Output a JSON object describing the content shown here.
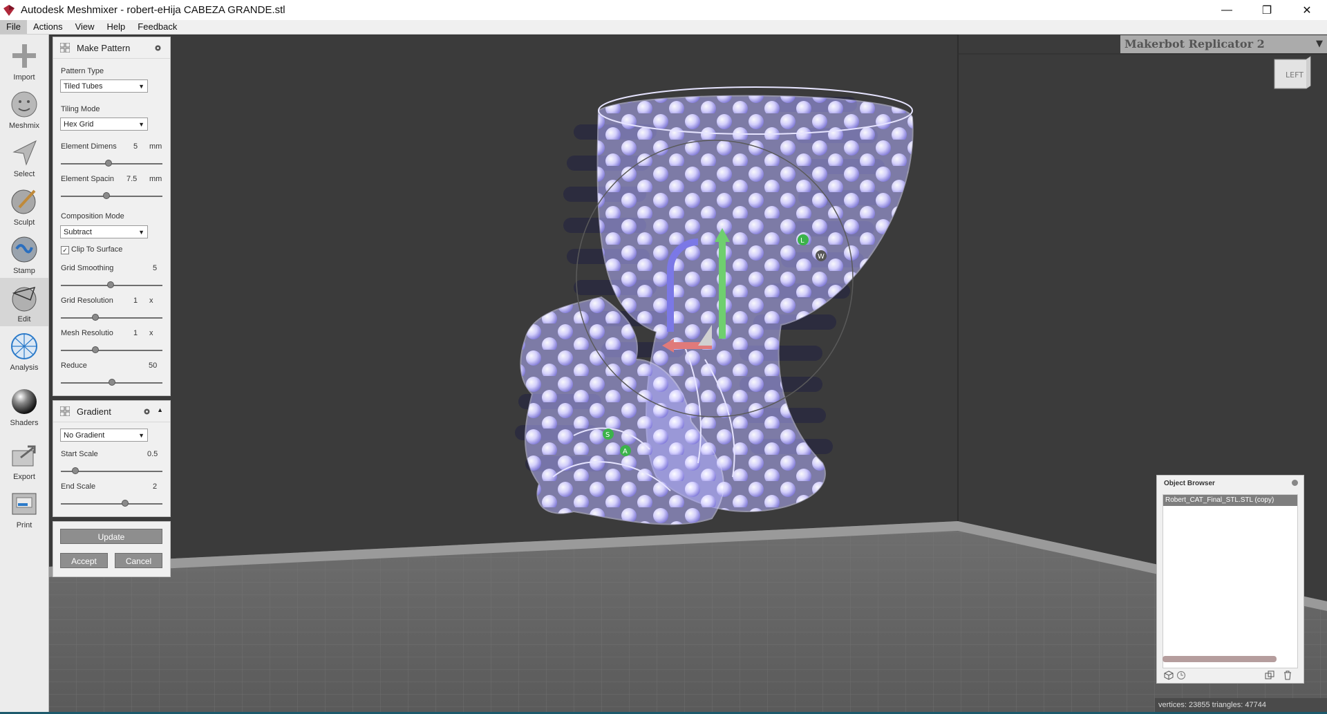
{
  "window": {
    "title": "Autodesk Meshmixer - robert-eHija CABEZA GRANDE.stl",
    "minimize": "—",
    "restore": "❐",
    "close": "✕"
  },
  "menu": [
    "File",
    "Actions",
    "View",
    "Help",
    "Feedback"
  ],
  "tools": [
    {
      "label": "Import",
      "icon": "plus-icon"
    },
    {
      "label": "Meshmix",
      "icon": "face-sphere-icon"
    },
    {
      "label": "Select",
      "icon": "arrow-select-icon"
    },
    {
      "label": "Sculpt",
      "icon": "brush-sphere-icon"
    },
    {
      "label": "Stamp",
      "icon": "stamp-sphere-icon"
    },
    {
      "label": "Edit",
      "icon": "edit-sphere-icon"
    },
    {
      "label": "Analysis",
      "icon": "mesh-sphere-icon"
    },
    {
      "label": "Shaders",
      "icon": "shader-sphere-icon"
    },
    {
      "label": "Export",
      "icon": "export-icon"
    },
    {
      "label": "Print",
      "icon": "printer-icon"
    }
  ],
  "make_pattern": {
    "title": "Make Pattern",
    "pattern_type_label": "Pattern Type",
    "pattern_type_value": "Tiled Tubes",
    "tiling_mode_label": "Tiling Mode",
    "tiling_mode_value": "Hex Grid",
    "element_dimens_label": "Element Dimens",
    "element_dimens_value": "5",
    "element_dimens_unit": "mm",
    "element_dimens_level": 0.47,
    "element_spacing_label": "Element Spacin",
    "element_spacing_value": "7.5",
    "element_spacing_unit": "mm",
    "element_spacing_level": 0.45,
    "composition_mode_label": "Composition Mode",
    "composition_mode_value": "Subtract",
    "clip_to_surface_label": "Clip To Surface",
    "clip_to_surface_checked": true,
    "grid_smoothing_label": "Grid Smoothing",
    "grid_smoothing_value": "5",
    "grid_smoothing_level": 0.49,
    "grid_resolution_label": "Grid Resolution",
    "grid_resolution_value": "1",
    "grid_resolution_unit": "x",
    "grid_resolution_level": 0.34,
    "mesh_resolution_label": "Mesh Resolutio",
    "mesh_resolution_value": "1",
    "mesh_resolution_unit": "x",
    "mesh_resolution_level": 0.34,
    "reduce_label": "Reduce",
    "reduce_value": "50",
    "reduce_level": 0.5
  },
  "gradient": {
    "title": "Gradient",
    "mode_value": "No Gradient",
    "start_scale_label": "Start Scale",
    "start_scale_value": "0.5",
    "start_scale_level": 0.14,
    "end_scale_label": "End Scale",
    "end_scale_value": "2",
    "end_scale_level": 0.63
  },
  "actions": {
    "update": "Update",
    "accept": "Accept",
    "cancel": "Cancel"
  },
  "printer": {
    "name": "Makerbot Replicator 2"
  },
  "viewcube": {
    "face": "LEFT"
  },
  "object_browser": {
    "title": "Object Browser",
    "items": [
      "Robert_CAT_Final_STL.STL (copy)"
    ]
  },
  "status": {
    "text": "vertices: 23855 triangles: 47744"
  },
  "gizmo": {
    "handles": [
      "L",
      "W",
      "S",
      "A"
    ]
  }
}
